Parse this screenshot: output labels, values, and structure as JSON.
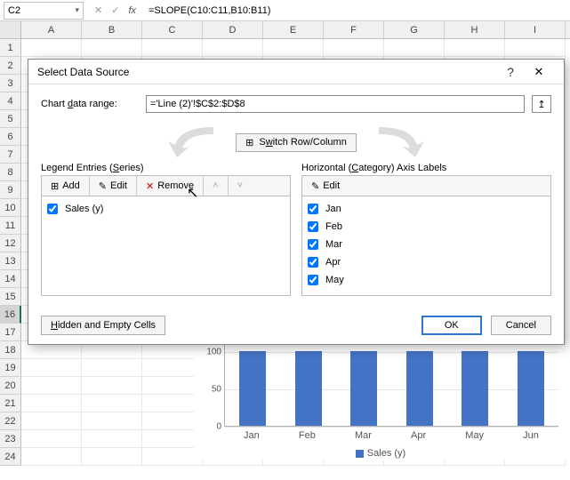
{
  "formula_bar": {
    "cell_ref": "C2",
    "formula": "=SLOPE(C10:C11,B10:B11)",
    "fx_label": "fx"
  },
  "columns": [
    "A",
    "B",
    "C",
    "D",
    "E",
    "F",
    "G",
    "H",
    "I"
  ],
  "rows": [
    "1",
    "2",
    "3",
    "4",
    "5",
    "6",
    "7",
    "8",
    "9",
    "10",
    "11",
    "12",
    "13",
    "14",
    "15",
    "16",
    "17",
    "18",
    "19",
    "20",
    "21",
    "22",
    "23",
    "24"
  ],
  "selected_row": "16",
  "dialog": {
    "title": "Select Data Source",
    "help_label": "?",
    "close_label": "✕",
    "range_label_pre": "Chart ",
    "range_label_u": "d",
    "range_label_post": "ata range:",
    "range_value": "='Line (2)'!$C$2:$D$8",
    "switch_label_pre": "S",
    "switch_label_u": "w",
    "switch_label_post": "itch Row/Column",
    "legend_panel_label": "Legend Entries (",
    "legend_panel_u": "S",
    "legend_panel_post": "eries)",
    "axis_panel_label": "Horizontal (",
    "axis_panel_u": "C",
    "axis_panel_post": "ategory) Axis Labels",
    "add_label": "Add",
    "edit_label": "Edit",
    "edit2_label": "Edit",
    "remove_label": "Remove",
    "series": [
      {
        "checked": true,
        "name": "Sales (y)"
      }
    ],
    "categories": [
      {
        "checked": true,
        "name": "Jan"
      },
      {
        "checked": true,
        "name": "Feb"
      },
      {
        "checked": true,
        "name": "Mar"
      },
      {
        "checked": true,
        "name": "Apr"
      },
      {
        "checked": true,
        "name": "May"
      }
    ],
    "hidden_label": "Hidden and Empty Cells",
    "ok_label": "OK",
    "cancel_label": "Cancel"
  },
  "chart_data": {
    "type": "bar",
    "categories": [
      "Jan",
      "Feb",
      "Mar",
      "Apr",
      "May",
      "Jun"
    ],
    "values": [
      100,
      100,
      100,
      100,
      100,
      100
    ],
    "legend": "Sales (y)",
    "yticks": [
      0,
      50,
      100
    ],
    "ylim": [
      0,
      110
    ]
  }
}
